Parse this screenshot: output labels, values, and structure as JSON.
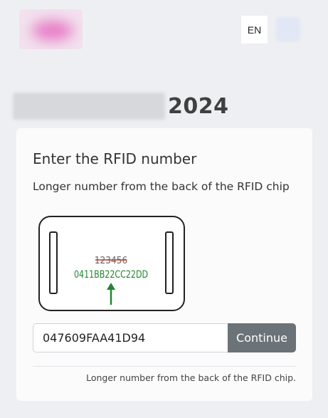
{
  "header": {
    "language_label": "EN"
  },
  "event": {
    "year": "2024"
  },
  "card": {
    "title": "Enter the RFID number",
    "subtitle": "Longer number from the back of the RFID chip",
    "illustration": {
      "short_number": "123456",
      "long_number": "0411BB22CC22DD",
      "arrow_color": "#22862f",
      "long_number_color": "#22862f",
      "short_number_strike_color": "#c0392b"
    },
    "input": {
      "value": "047609FAA41D94"
    },
    "continue_label": "Continue",
    "help_text": "Longer number from the back of the RFID chip."
  },
  "colors": {
    "page_background": "#eeeff2",
    "card_background": "#fbfbfb",
    "button_background": "#6b7278"
  }
}
